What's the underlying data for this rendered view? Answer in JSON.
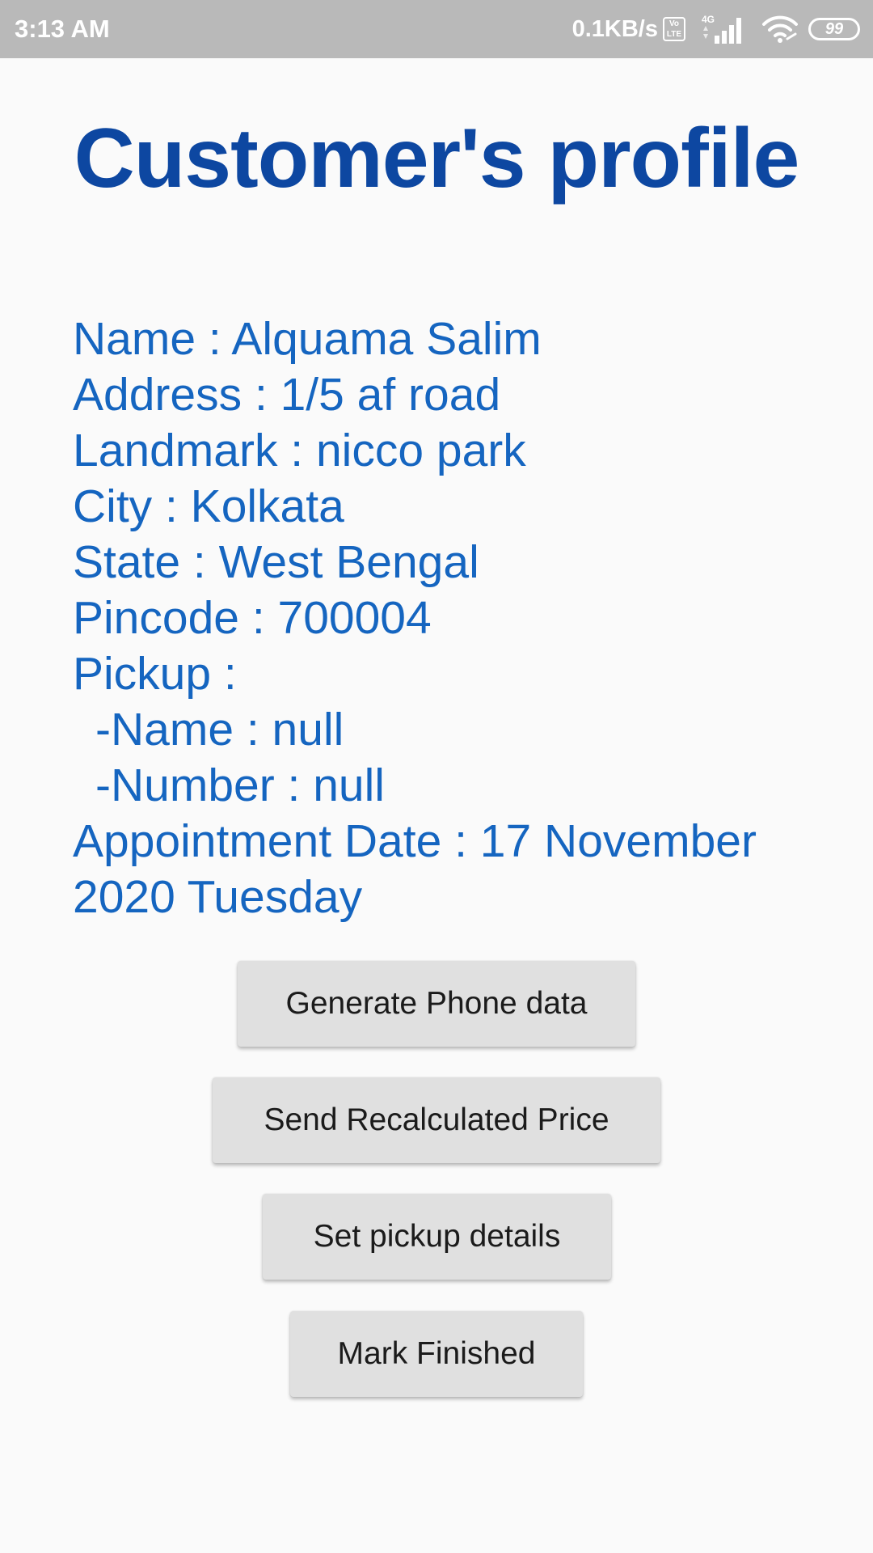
{
  "status_bar": {
    "time": "3:13 AM",
    "net_speed": "0.1KB/s",
    "volte_top": "Vo",
    "volte_bottom": "LTE",
    "network_type": "4G",
    "battery": "99"
  },
  "page": {
    "title": "Customer's profile"
  },
  "profile": {
    "name": "Name : Alquama Salim",
    "address": "Address : 1/5 af road",
    "landmark": "Landmark : nicco park",
    "city": "City : Kolkata",
    "state": "State : West Bengal",
    "pincode": "Pincode : 700004",
    "pickup_label": "Pickup :",
    "pickup_name": "-Name : null",
    "pickup_number": "-Number : null",
    "appointment": "Appointment Date : 17 November 2020 Tuesday"
  },
  "actions": {
    "generate_phone_data": "Generate Phone data",
    "send_recalculated_price": "Send Recalculated Price",
    "set_pickup_details": "Set pickup details",
    "mark_finished": "Mark Finished"
  },
  "colors": {
    "title": "#0d47a1",
    "text": "#1565c0",
    "button_bg": "#e0e0e0",
    "status_bar_bg": "#b9b9b9",
    "background": "#fafafa"
  }
}
